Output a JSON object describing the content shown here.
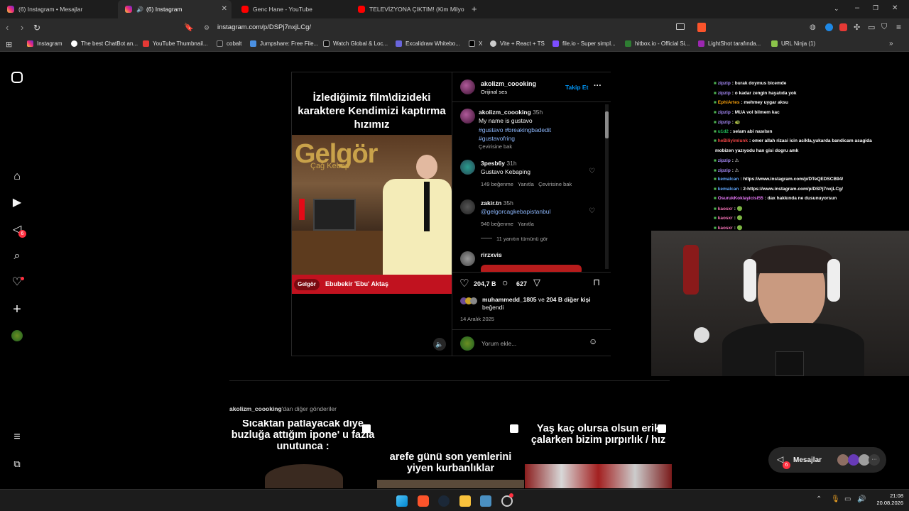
{
  "tabs": [
    {
      "label": "(6) Instagram • Mesajlar",
      "active": false
    },
    {
      "label": "(6) Instagram",
      "active": true
    },
    {
      "label": "Genc Hane - YouTube",
      "active": false
    },
    {
      "label": "TELEVİZYONA ÇIKTIM! (Kim Milyoner",
      "active": false
    }
  ],
  "new_tab_glyph": "+",
  "address": {
    "url": "instagram.com/p/DSPj7nxjLCg/"
  },
  "bookmarks": [
    "Instagram",
    "The best ChatBot an...",
    "YouTube Thumbnail...",
    "cobalt",
    "Jumpshare: Free File...",
    "Watch Global & Loc...",
    "Excalidraw Whitebo...",
    "X",
    "Vite + React + TS",
    "file.io - Super simpl...",
    "hitbox.io - Official Si...",
    "LightShot tarafında...",
    "URL Ninja (1)"
  ],
  "sidebar": {
    "notifications_badge": "6"
  },
  "post": {
    "overlay_title": "İzlediğimiz film\\dizideki karaktere Kendimizi kaptırma hızımız",
    "sign_text": "Gelgör",
    "sign_sub": "Çağ Kebap",
    "lower_third": "Ebubekir 'Ebu' Aktaş",
    "lower_logo": "Gelgör",
    "author": "akolizm_coooking",
    "audio": "Orijinal ses",
    "follow": "Takip Et",
    "caption": {
      "user": "akolizm_coooking",
      "time": "35h",
      "text": "My name is gustavo",
      "tags1": "#gustavo #breakingbadedit",
      "tags2": "#gustavofring",
      "translate": "Çevirisine bak"
    },
    "comments": [
      {
        "user": "3pesb6y",
        "time": "31h",
        "text": "Gustavo Kebaping",
        "likes": "149 beğenme",
        "reply": "Yanıtla",
        "translate": "Çevirisine bak"
      },
      {
        "user": "zakir.tn",
        "time": "35h",
        "text": "@gelgorcagkebapistanbul",
        "likes": "940 beğenme",
        "reply": "Yanıtla",
        "view_replies": "11 yanıtın tümünü gör"
      },
      {
        "user": "rirzxvis",
        "time": "",
        "text": "",
        "likes": "",
        "reply": ""
      }
    ],
    "likes_count": "204,7 B",
    "comments_count": "627",
    "liked_by_user": "muhammedd_1805",
    "liked_by_rest": "ve",
    "liked_by_count": "204 B diğer kişi",
    "liked_by_tail": "beğendi",
    "date": "14 Aralık 2025",
    "comment_placeholder": "Yorum ekle..."
  },
  "more_posts": {
    "user": "akolizm_coooking",
    "suffix": "'dan diğer gönderiler"
  },
  "thumbs": [
    "Sıcaktan patlayacak diye buzluğa attığım ipone' u fazla unutunca :",
    "arefe günü son yemlerini yiyen kurbanlıklar",
    "Yaş kaç olursa olsun erik çalarken bizim pırpırlık / hız"
  ],
  "chat": [
    {
      "user": "zipzip",
      "text": ": burak doymus bicemde",
      "color": "#a78bfa"
    },
    {
      "user": "zipzip",
      "text": ": o kadar zengin hayatıda yok",
      "color": "#a78bfa"
    },
    {
      "user": "EphiArtes",
      "text": ": mehmey uygar aksu",
      "color": "#f59e0b"
    },
    {
      "user": "zipzip",
      "text": ": MUA vol bilmem kac",
      "color": "#a78bfa"
    },
    {
      "user": "zipzip",
      "text": ": 🐢",
      "color": "#a78bfa"
    },
    {
      "user": "u1d2",
      "text": ": selam abi nasılsın",
      "color": "#22c55e"
    },
    {
      "user": "heBiliyimlunk",
      "text": ": omer allah rizasi icin acikla,yukarda bandicam asagida",
      "color": "#ef4444"
    },
    {
      "user": "",
      "text": "mobizen yazıyodu han gisi dogru amk",
      "color": "#fff"
    },
    {
      "user": "zipzip",
      "text": ": ⚠",
      "color": "#a78bfa"
    },
    {
      "user": "zipzip",
      "text": ": ⚠",
      "color": "#a78bfa"
    },
    {
      "user": "kemalcan",
      "text": ": https://www.instagram.com/p/DTeQEDSCB94/",
      "color": "#60a5fa"
    },
    {
      "user": "kemalcan",
      "text": ": 2-https://www.instagram.com/p/DSPj7nxjLCg/",
      "color": "#60a5fa"
    },
    {
      "user": "OsurukKoklayicisi55",
      "text": ": dax hakkında ne dusunuyorsun",
      "color": "#e879f9"
    },
    {
      "user": "kaosxr",
      "text": ": 🟢",
      "color": "#f472b6"
    },
    {
      "user": "kaosxr",
      "text": ": 🟢",
      "color": "#f472b6"
    },
    {
      "user": "kaosxr",
      "text": ": 🟢",
      "color": "#f472b6"
    }
  ],
  "messages": {
    "label": "Mesajlar",
    "badge": "6"
  },
  "clock": {
    "time": "21:08",
    "date": "20.08.2026"
  },
  "colors": {
    "accent": "#0095f6",
    "danger": "#ff3040",
    "bg": "#000000"
  }
}
